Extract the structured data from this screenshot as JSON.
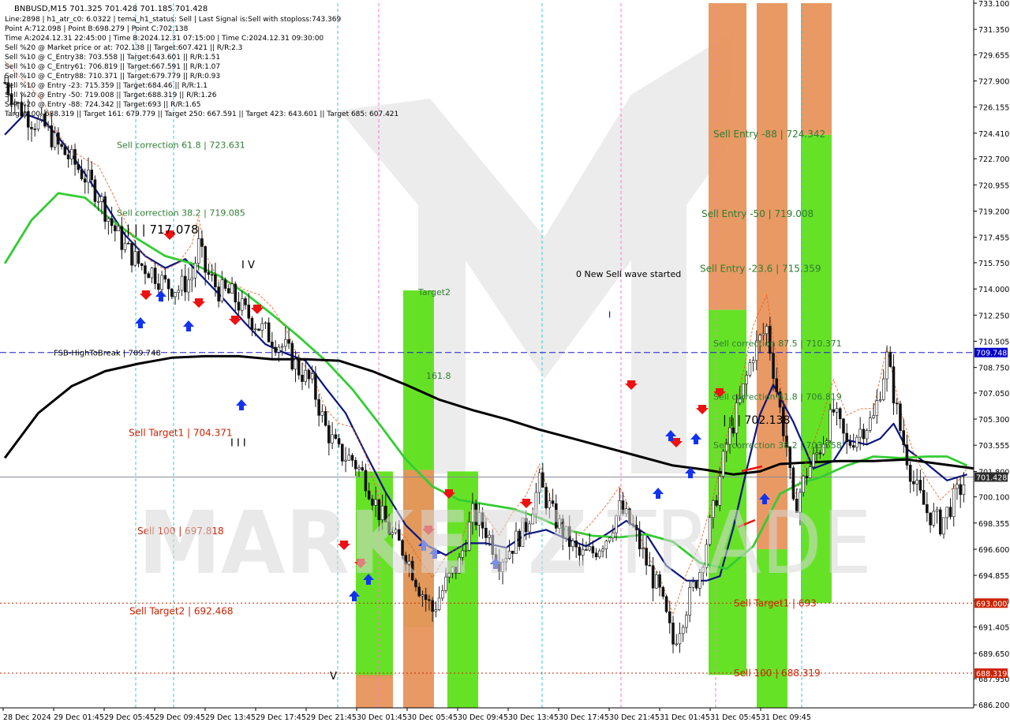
{
  "header": {
    "symbol": "BNBUSD,M15  701.325 701.428 701.185 701.428",
    "lines": [
      "Line:2898 | h1_atr_c0: 6.0322 | tema_h1_status: Sell | Last Signal is:Sell with stoploss:743.369",
      "Point A:712.098 | Point B:698.279 | Point C:702.138",
      "Time A:2024.12.31 22:45:00 | Time B:2024.12.31 07:15:00 | Time C:2024.12.31 09:30:00",
      "Sell %20 @ Market price or at: 702.138 || Target:607.421 || R/R:2.3",
      "Sell %10 @ C_Entry38: 703.558 || Target:643.601 || R/R:1.51",
      "Sell %10 @ C_Entry61: 706.819 || Target:667.591 || R/R:1.07",
      "Sell %10 @ C_Entry88: 710.371 || Target:679.779 || R/R:0.93",
      "Sell %10 @ Entry -23: 715.359 || Target:684.46 || R/R:1.1",
      "Sell %20 @ Entry -50: 719.008 || Target:688.319 || R/R:1.26",
      "Sell %20 @ Entry -88: 724.342 || Target:693 || R/R:1.65",
      "Target100: 688.319 || Target 161: 679.779 || Target 250: 667.591 || Target 423: 643.601 || Target 685: 607.421"
    ]
  },
  "watermark": {
    "left": "MARKETZ",
    "right": "TRADE"
  },
  "chart_data": {
    "type": "candlestick",
    "ylim": [
      686.0,
      733.1
    ],
    "y_ticks": [
      "733.100",
      "731.350",
      "729.655",
      "727.900",
      "726.155",
      "724.410",
      "722.700",
      "720.955",
      "719.200",
      "717.455",
      "715.750",
      "714.000",
      "712.250",
      "710.505",
      "708.750",
      "707.050",
      "705.300",
      "703.555",
      "701.800",
      "700.100",
      "698.355",
      "696.600",
      "694.855",
      "693.150",
      "691.405",
      "689.650",
      "687.950",
      "686.200"
    ],
    "x_labels": [
      "28 Dec 2024",
      "29 Dec 01:45",
      "29 Dec 05:45",
      "29 Dec 09:45",
      "29 Dec 13:45",
      "29 Dec 17:45",
      "29 Dec 21:45",
      "30 Dec 01:45",
      "30 Dec 05:45",
      "30 Dec 09:45",
      "30 Dec 13:45",
      "30 Dec 17:45",
      "30 Dec 21:45",
      "31 Dec 01:45",
      "31 Dec 05:45",
      "31 Dec 09:45"
    ],
    "current_price": "701.428",
    "price_badges": [
      {
        "value": 709.748,
        "label": "709.748",
        "color": "#0000cc"
      },
      {
        "value": 701.428,
        "label": "701.428",
        "color": "#2b2b2b"
      },
      {
        "value": 693.0,
        "label": "693.000",
        "color": "#cc2200"
      },
      {
        "value": 688.319,
        "label": "688.319",
        "color": "#cc2200"
      }
    ],
    "levels": [
      {
        "name": "FSB-HighToBreak",
        "value": 709.748,
        "style": "blue-dash"
      },
      {
        "name": "current",
        "value": 701.428,
        "style": "grey-solid"
      },
      {
        "name": "Sell Target1",
        "value": 693.0,
        "style": "red-dot"
      },
      {
        "name": "Sell 100",
        "value": 688.319,
        "style": "red-dot"
      }
    ],
    "annotations": [
      {
        "text": "Sell correction 61.8 | 723.631",
        "price": 723.631,
        "color": "#2e7d32"
      },
      {
        "text": "| | | 717.078",
        "price": 717.9,
        "color": "#000000"
      },
      {
        "text": "Sell correction 38.2 | 719.085",
        "price": 719.085,
        "color": "#2e7d32"
      },
      {
        "text": "I V",
        "price": 715.6,
        "color": "#000000"
      },
      {
        "text": "FSB-HighToBreak | 709.748",
        "price": 709.748,
        "color": "#000000"
      },
      {
        "text": "Sell Target1 | 704.371",
        "price": 704.371,
        "color": "#cc2200"
      },
      {
        "text": "I I I",
        "price": 703.7,
        "color": "#000000"
      },
      {
        "text": "Sell 100 | 697.818",
        "price": 697.818,
        "color": "#cc2200"
      },
      {
        "text": "Sell Target2 | 692.468",
        "price": 692.468,
        "color": "#cc2200"
      },
      {
        "text": "V",
        "price": 688.1,
        "color": "#000000"
      },
      {
        "text": "Target2",
        "price": 713.8,
        "color": "#2e7d32"
      },
      {
        "text": "161.8",
        "price": 708.2,
        "color": "#2e7d32"
      },
      {
        "text": "0 New Sell wave started",
        "price": 715.0,
        "color": "#000000"
      },
      {
        "text": "I",
        "price": 712.3,
        "color": "#0000cc"
      },
      {
        "text": "Sell Entry -88 | 724.342",
        "price": 724.342,
        "color": "#2e7d32"
      },
      {
        "text": "Sell Entry -50 | 719.008",
        "price": 719.008,
        "color": "#2e7d32"
      },
      {
        "text": "Sell Entry -23.6 | 715.359",
        "price": 715.359,
        "color": "#2e7d32"
      },
      {
        "text": "Sell correction 87.5 | 710.371",
        "price": 710.371,
        "color": "#2e7d32"
      },
      {
        "text": "Sell correction 61.8 | 706.819",
        "price": 706.819,
        "color": "#2e7d32"
      },
      {
        "text": "| | | 702.138",
        "price": 705.2,
        "color": "#000000"
      },
      {
        "text": "Sell correction 38.2 | 703.558",
        "price": 703.558,
        "color": "#2e7d32"
      },
      {
        "text": "Sell Target1 | 693",
        "price": 693.0,
        "color": "#cc2200"
      },
      {
        "text": "Sell 100 | 688.319",
        "price": 688.319,
        "color": "#cc2200"
      }
    ],
    "zones": [
      {
        "name": "green-zone-1",
        "top": 701.8,
        "bottom": 688.0,
        "color": "#5ee01a"
      },
      {
        "name": "orange-zone-1",
        "top": 688.2,
        "bottom": 686.0,
        "color": "#e8935c"
      },
      {
        "name": "green-zone-2",
        "top": 713.9,
        "bottom": 691.4,
        "color": "#5ee01a"
      },
      {
        "name": "orange-zone-2",
        "top": 701.9,
        "bottom": 686.0,
        "color": "#e8935c"
      },
      {
        "name": "green-zone-3",
        "top": 701.8,
        "bottom": 686.0,
        "color": "#5ee01a"
      },
      {
        "name": "orange-zone-entry-left",
        "top": 733.1,
        "bottom": 712.6,
        "color": "#e8935c"
      },
      {
        "name": "green-zone-entry-left",
        "top": 712.6,
        "bottom": 688.2,
        "color": "#5ee01a"
      },
      {
        "name": "orange-zone-entry-mid",
        "top": 733.1,
        "bottom": 696.6,
        "color": "#e8935c"
      },
      {
        "name": "green-zone-entry-mid",
        "top": 696.6,
        "bottom": 686.0,
        "color": "#5ee01a"
      },
      {
        "name": "orange-zone-entry-right",
        "top": 733.1,
        "bottom": 724.3,
        "color": "#e8935c"
      },
      {
        "name": "green-zone-entry-right",
        "top": 724.3,
        "bottom": 693.0,
        "color": "#5ee01a"
      }
    ],
    "series": [
      {
        "name": "close",
        "points": [
          [
            0,
            727.8
          ],
          [
            4,
            726.2
          ],
          [
            8,
            725.3
          ],
          [
            12,
            724.8
          ],
          [
            16,
            723.5
          ],
          [
            20,
            722.6
          ],
          [
            24,
            721.5
          ],
          [
            28,
            720.3
          ],
          [
            32,
            718.3
          ],
          [
            36,
            716.8
          ],
          [
            40,
            715.7
          ],
          [
            44,
            715.2
          ],
          [
            48,
            714.3
          ],
          [
            52,
            714.0
          ],
          [
            56,
            714.8
          ],
          [
            58,
            716.9
          ],
          [
            60,
            715.2
          ],
          [
            64,
            713.9
          ],
          [
            68,
            713.6
          ],
          [
            72,
            712.4
          ],
          [
            76,
            711.5
          ],
          [
            80,
            710.7
          ],
          [
            84,
            710.0
          ],
          [
            88,
            708.6
          ],
          [
            92,
            707.6
          ],
          [
            96,
            704.7
          ],
          [
            100,
            703.0
          ],
          [
            104,
            702.6
          ],
          [
            108,
            701.3
          ],
          [
            112,
            699.1
          ],
          [
            116,
            697.5
          ],
          [
            120,
            696.3
          ],
          [
            124,
            694.1
          ],
          [
            128,
            692.5
          ],
          [
            132,
            694.3
          ],
          [
            136,
            695.7
          ],
          [
            140,
            698.9
          ],
          [
            144,
            697.9
          ],
          [
            148,
            695.9
          ],
          [
            152,
            696.9
          ],
          [
            156,
            698.2
          ],
          [
            160,
            701.0
          ],
          [
            164,
            698.9
          ],
          [
            168,
            697.4
          ],
          [
            172,
            696.1
          ],
          [
            176,
            696.4
          ],
          [
            180,
            697.4
          ],
          [
            184,
            699.3
          ],
          [
            188,
            698.0
          ],
          [
            192,
            695.7
          ],
          [
            196,
            693.6
          ],
          [
            200,
            690.3
          ],
          [
            204,
            692.8
          ],
          [
            208,
            695.2
          ],
          [
            212,
            699.1
          ],
          [
            216,
            703.6
          ],
          [
            220,
            706.4
          ],
          [
            224,
            709.8
          ],
          [
            228,
            711.4
          ],
          [
            232,
            705.9
          ],
          [
            234,
            703.5
          ],
          [
            236,
            699.2
          ],
          [
            240,
            701.7
          ],
          [
            244,
            703.4
          ],
          [
            248,
            705.8
          ],
          [
            252,
            703.5
          ],
          [
            256,
            704.6
          ],
          [
            260,
            705.3
          ],
          [
            264,
            709.4
          ],
          [
            268,
            704.6
          ],
          [
            272,
            701.0
          ],
          [
            276,
            699.1
          ],
          [
            280,
            698.3
          ],
          [
            284,
            699.9
          ],
          [
            288,
            701.4
          ]
        ],
        "color": "#111111"
      },
      {
        "name": "ma-blue",
        "points": [
          [
            0,
            724.3
          ],
          [
            6,
            725.7
          ],
          [
            12,
            725.2
          ],
          [
            18,
            723.6
          ],
          [
            24,
            721.7
          ],
          [
            30,
            719.7
          ],
          [
            36,
            717.6
          ],
          [
            42,
            716.2
          ],
          [
            48,
            715.4
          ],
          [
            54,
            716.0
          ],
          [
            60,
            714.6
          ],
          [
            66,
            713.2
          ],
          [
            72,
            711.7
          ],
          [
            78,
            710.3
          ],
          [
            84,
            709.7
          ],
          [
            90,
            709.2
          ],
          [
            96,
            707.4
          ],
          [
            102,
            705.7
          ],
          [
            108,
            703.0
          ],
          [
            114,
            700.4
          ],
          [
            120,
            698.2
          ],
          [
            126,
            696.9
          ],
          [
            132,
            696.2
          ],
          [
            138,
            697.0
          ],
          [
            144,
            697.0
          ],
          [
            150,
            696.7
          ],
          [
            156,
            697.6
          ],
          [
            162,
            697.9
          ],
          [
            168,
            697.3
          ],
          [
            174,
            696.8
          ],
          [
            180,
            697.6
          ],
          [
            186,
            698.5
          ],
          [
            192,
            697.6
          ],
          [
            198,
            695.5
          ],
          [
            204,
            694.5
          ],
          [
            210,
            694.5
          ],
          [
            214,
            694.8
          ],
          [
            218,
            698.0
          ],
          [
            222,
            701.9
          ],
          [
            226,
            705.6
          ],
          [
            230,
            707.6
          ],
          [
            236,
            705.1
          ],
          [
            242,
            702.0
          ],
          [
            248,
            702.5
          ],
          [
            252,
            703.9
          ],
          [
            258,
            703.6
          ],
          [
            262,
            704.0
          ],
          [
            266,
            705.0
          ],
          [
            270,
            703.3
          ],
          [
            276,
            702.3
          ],
          [
            282,
            701.2
          ],
          [
            288,
            701.6
          ]
        ],
        "color": "#0a1480"
      },
      {
        "name": "ma-green",
        "points": [
          [
            0,
            715.7
          ],
          [
            8,
            718.6
          ],
          [
            16,
            720.4
          ],
          [
            24,
            720.1
          ],
          [
            32,
            718.6
          ],
          [
            40,
            717.3
          ],
          [
            48,
            716.2
          ],
          [
            56,
            715.7
          ],
          [
            64,
            714.9
          ],
          [
            72,
            713.7
          ],
          [
            80,
            712.3
          ],
          [
            88,
            710.8
          ],
          [
            96,
            709.2
          ],
          [
            104,
            707.3
          ],
          [
            112,
            705.0
          ],
          [
            120,
            702.6
          ],
          [
            128,
            700.8
          ],
          [
            136,
            699.9
          ],
          [
            144,
            699.6
          ],
          [
            152,
            699.3
          ],
          [
            160,
            698.7
          ],
          [
            168,
            697.9
          ],
          [
            176,
            697.5
          ],
          [
            184,
            697.4
          ],
          [
            192,
            697.6
          ],
          [
            200,
            697.1
          ],
          [
            208,
            695.7
          ],
          [
            216,
            695.3
          ],
          [
            224,
            696.8
          ],
          [
            232,
            700.3
          ],
          [
            238,
            701.0
          ],
          [
            244,
            701.4
          ],
          [
            252,
            702.2
          ],
          [
            260,
            702.8
          ],
          [
            268,
            702.7
          ],
          [
            276,
            702.8
          ],
          [
            282,
            702.8
          ],
          [
            288,
            702.2
          ]
        ],
        "color": "#33cc33"
      },
      {
        "name": "ma-black",
        "points": [
          [
            0,
            702.7
          ],
          [
            10,
            705.7
          ],
          [
            20,
            707.5
          ],
          [
            30,
            708.5
          ],
          [
            40,
            709.0
          ],
          [
            50,
            709.4
          ],
          [
            60,
            709.5
          ],
          [
            70,
            709.5
          ],
          [
            80,
            709.3
          ],
          [
            90,
            709.3
          ],
          [
            100,
            709.2
          ],
          [
            110,
            708.5
          ],
          [
            120,
            707.6
          ],
          [
            130,
            706.6
          ],
          [
            140,
            705.9
          ],
          [
            150,
            705.3
          ],
          [
            160,
            704.6
          ],
          [
            170,
            704.0
          ],
          [
            180,
            703.4
          ],
          [
            190,
            702.8
          ],
          [
            200,
            702.2
          ],
          [
            210,
            701.9
          ],
          [
            218,
            701.6
          ],
          [
            226,
            701.8
          ],
          [
            232,
            702.3
          ],
          [
            240,
            702.4
          ],
          [
            250,
            702.5
          ],
          [
            260,
            702.5
          ],
          [
            270,
            702.6
          ],
          [
            280,
            702.3
          ],
          [
            290,
            702.0
          ]
        ],
        "color": "#000000"
      }
    ]
  }
}
